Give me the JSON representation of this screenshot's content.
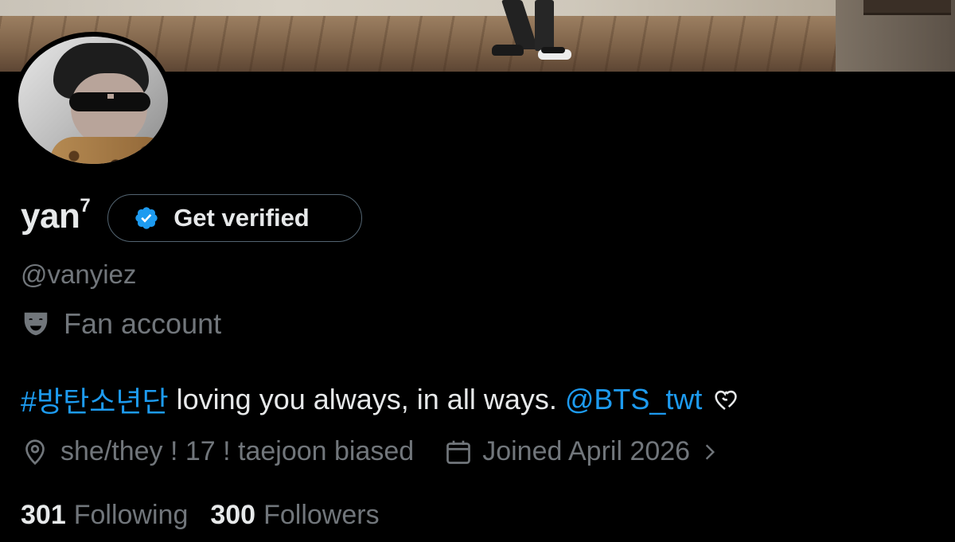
{
  "profile": {
    "display_name": "yan",
    "display_name_sup": "7",
    "verify_button_label": "Get verified",
    "handle": "@vanyiez",
    "category": "Fan account",
    "bio": {
      "hashtag": "#방탄소년단",
      "text": " loving you always, in all ways. ",
      "mention": "@BTS_twt"
    },
    "location": "she/they ! 17 ! taejoon biased",
    "joined": "Joined April 2026",
    "following_count": "301",
    "following_label": "Following",
    "followers_count": "300",
    "followers_label": "Followers"
  },
  "icons": {
    "verify": "verified-badge-icon",
    "category": "theater-mask-icon",
    "bio_end": "heart-outline-icon",
    "location": "location-pin-icon",
    "joined": "calendar-icon",
    "more": "chevron-right-icon"
  },
  "colors": {
    "background": "#000000",
    "text_primary": "#e7e9ea",
    "text_secondary": "#71767b",
    "link": "#1d9bf0",
    "border": "#536471"
  }
}
